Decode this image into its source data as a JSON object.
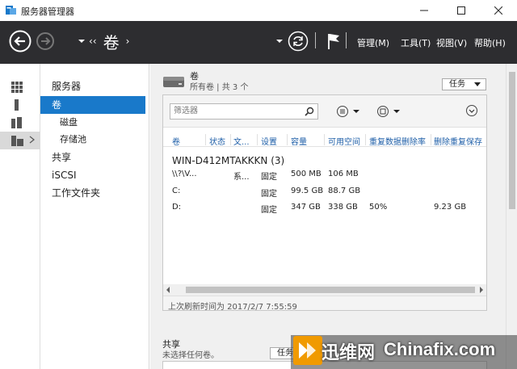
{
  "window": {
    "title": "服务器管理器"
  },
  "nav": {
    "breadcrumb_sep_left": "‹‹",
    "breadcrumb": "卷",
    "breadcrumb_sep_right": "›",
    "menus": [
      "管理(M)",
      "工具(T)",
      "视图(V)",
      "帮助(H)"
    ]
  },
  "left_nav": [
    {
      "label": "服务器",
      "active": false,
      "sub": false
    },
    {
      "label": "卷",
      "active": true,
      "sub": false
    },
    {
      "label": "磁盘",
      "active": false,
      "sub": true
    },
    {
      "label": "存储池",
      "active": false,
      "sub": true
    },
    {
      "label": "共享",
      "active": false,
      "sub": false
    },
    {
      "label": "iSCSI",
      "active": false,
      "sub": false
    },
    {
      "label": "工作文件夹",
      "active": false,
      "sub": false
    }
  ],
  "volumes": {
    "title": "卷",
    "subtitle": "所有卷 | 共 3 个",
    "task_label": "任务",
    "filter_placeholder": "筛选器",
    "columns": [
      "卷",
      "状态",
      "文...",
      "设置",
      "容量",
      "可用空间",
      "重复数据删除率",
      "删除重复保存"
    ],
    "group": "WIN-D412MTAKKKN (3)",
    "rows": [
      [
        "\\\\?\\V...",
        "",
        "系...",
        "固定",
        "500 MB",
        "106 MB",
        "",
        ""
      ],
      [
        "C:",
        "",
        "",
        "固定",
        "99.5 GB",
        "88.7 GB",
        "",
        ""
      ],
      [
        "D:",
        "",
        "",
        "固定",
        "347 GB",
        "338 GB",
        "50%",
        "9.23 GB"
      ]
    ],
    "status": "上次刷新时间为 2017/2/7 7:55:59"
  },
  "shares": {
    "title": "共享",
    "subtitle": "未选择任何卷。",
    "task_label": "任务"
  },
  "watermark": {
    "cn": "迅维网",
    "en": "Chinafix.com"
  },
  "colors": {
    "accent": "#1979ca",
    "navbar": "#2d2d30",
    "header_text": "#1f5fa8"
  }
}
